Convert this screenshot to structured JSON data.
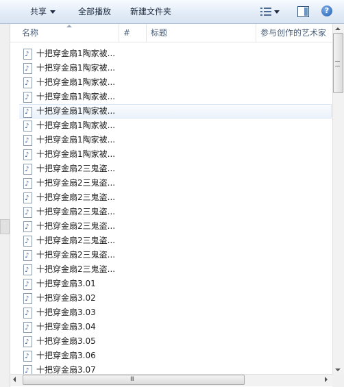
{
  "toolbar": {
    "share_label": "共享",
    "play_all_label": "全部播放",
    "new_folder_label": "新建文件夹",
    "view_icon": "view-options-icon",
    "preview_pane_icon": "preview-pane-icon",
    "help_icon": "help-icon",
    "help_glyph": "?"
  },
  "columns": {
    "name": "名称",
    "number": "#",
    "title": "标题",
    "artist": "参与创作的艺术家"
  },
  "files": [
    "十把穿金扇1陶家被...",
    "十把穿金扇1陶家被...",
    "十把穿金扇1陶家被...",
    "十把穿金扇1陶家被...",
    "十把穿金扇1陶家被...",
    "十把穿金扇1陶家被...",
    "十把穿金扇1陶家被...",
    "十把穿金扇1陶家被...",
    "十把穿金扇2三鬼盗...",
    "十把穿金扇2三鬼盗...",
    "十把穿金扇2三鬼盗...",
    "十把穿金扇2三鬼盗...",
    "十把穿金扇2三鬼盗...",
    "十把穿金扇2三鬼盗...",
    "十把穿金扇2三鬼盗...",
    "十把穿金扇2三鬼盗...",
    "十把穿金扇3.01",
    "十把穿金扇3.02",
    "十把穿金扇3.03",
    "十把穿金扇3.04",
    "十把穿金扇3.05",
    "十把穿金扇3.06",
    "十把穿金扇3.07"
  ],
  "highlighted_row": 4,
  "scrollbar": {
    "h_grip": "III"
  }
}
